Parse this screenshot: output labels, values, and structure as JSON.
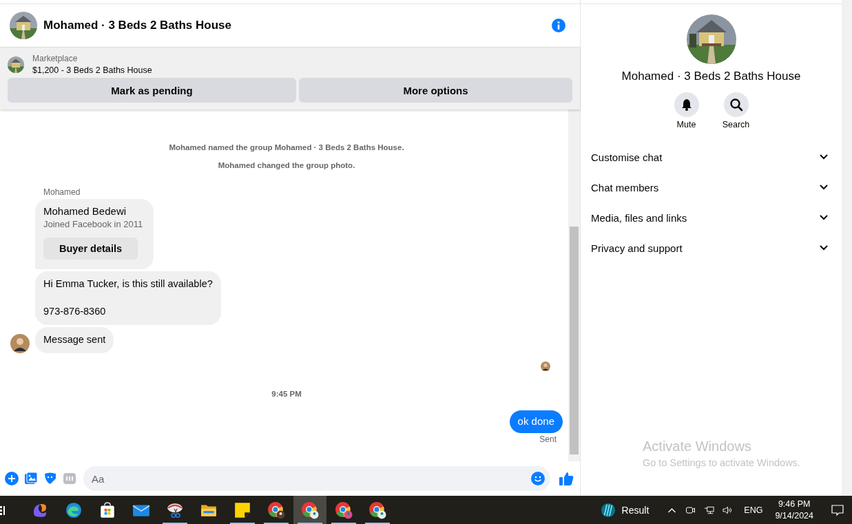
{
  "chat_header": {
    "title": "Mohamed · 3 Beds 2 Baths House"
  },
  "listing": {
    "source": "Marketplace",
    "title": "$1,200 - 3 Beds 2 Baths House",
    "buttons": [
      "Mark as pending",
      "More options"
    ]
  },
  "events": [
    "Mohamed named the group Mohamed · 3 Beds 2 Baths House.",
    "Mohamed changed the group photo."
  ],
  "thread": {
    "sender": "Mohamed",
    "profile_card": {
      "name": "Mohamed Bedewi",
      "joined": "Joined Facebook in 2011",
      "button": "Buyer details"
    },
    "messages": [
      {
        "text": "Hi Emma Tucker, is this still available?\n\n973-876-8360"
      },
      {
        "text": "Message sent"
      }
    ]
  },
  "timestamp": "9:45 PM",
  "outgoing": {
    "text": "ok done",
    "status": "Sent"
  },
  "composer": {
    "placeholder": "Aa"
  },
  "details": {
    "title": "Mohamed · 3 Beds 2 Baths House",
    "actions": [
      {
        "label": "Mute",
        "kind": "mute"
      },
      {
        "label": "Search",
        "kind": "search"
      }
    ],
    "sections": [
      {
        "label": "Customise chat",
        "expanded": false
      },
      {
        "label": "Chat members",
        "expanded": false
      },
      {
        "label": "Media, files and links",
        "expanded": false
      },
      {
        "label": "Privacy and support",
        "expanded": false
      }
    ]
  },
  "activation_notice": {
    "title": "Activate Windows",
    "subtitle": "Go to Settings to activate Windows."
  },
  "taskbar": {
    "apps": [
      {
        "kind": "swirl",
        "running": false,
        "selected": false
      },
      {
        "kind": "wave",
        "running": false,
        "selected": false
      },
      {
        "kind": "bag",
        "running": false,
        "selected": false
      },
      {
        "kind": "mail",
        "running": false,
        "selected": false
      },
      {
        "kind": "scissors",
        "running": true,
        "selected": false
      },
      {
        "kind": "folder",
        "running": false,
        "selected": false
      },
      {
        "kind": "note",
        "running": true,
        "selected": false
      },
      {
        "kind": "browser",
        "running": true,
        "selected": false
      },
      {
        "kind": "browser",
        "running": true,
        "selected": true
      },
      {
        "kind": "browser",
        "running": true,
        "selected": false
      },
      {
        "kind": "browser",
        "running": true,
        "selected": false
      }
    ],
    "widget": "Result",
    "language": "ENG",
    "time": "9:46 PM",
    "date": "9/14/2024"
  }
}
